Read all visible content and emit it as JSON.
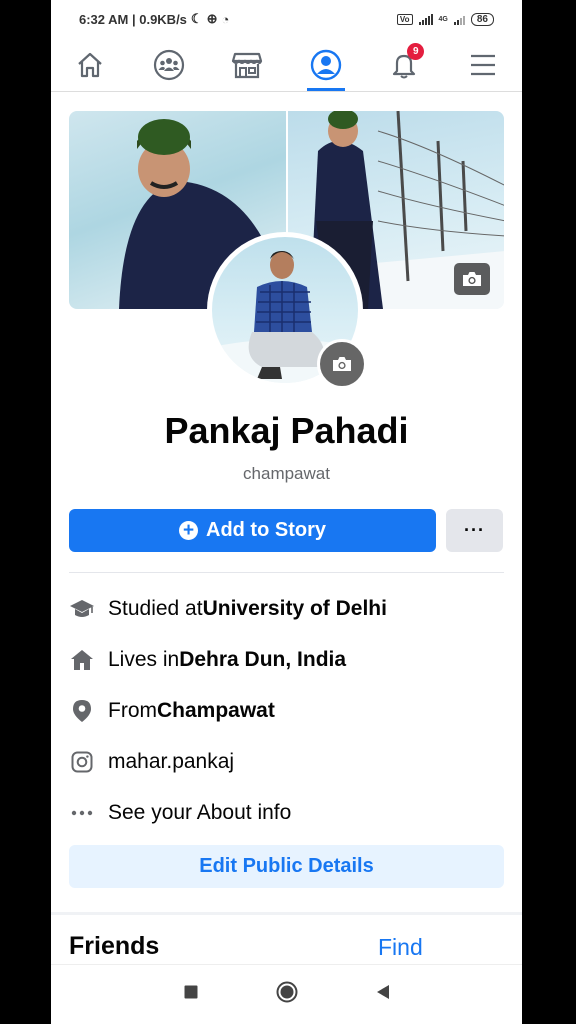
{
  "status_bar": {
    "time_speed": "6:32 AM | 0.9KB/s",
    "network_label": "4G",
    "battery": "86"
  },
  "nav": {
    "notification_count": "9"
  },
  "profile": {
    "name": "Pankaj Pahadi",
    "bio": "champawat",
    "add_story_label": "Add to Story",
    "more_label": "···"
  },
  "details": [
    {
      "prefix": "Studied at ",
      "bold": "University of Delhi",
      "icon": "graduation-cap-icon"
    },
    {
      "prefix": "Lives in ",
      "bold": "Dehra Dun, India",
      "icon": "home-icon"
    },
    {
      "prefix": "From ",
      "bold": "Champawat",
      "icon": "location-pin-icon"
    },
    {
      "prefix": "mahar.pankaj",
      "bold": "",
      "icon": "instagram-icon"
    },
    {
      "prefix": "See your About info",
      "bold": "",
      "icon": "more-dots-icon"
    }
  ],
  "edit_public_details_label": "Edit Public Details",
  "friends": {
    "title": "Friends",
    "find_label": "Find"
  },
  "colors": {
    "brand_blue": "#1877f2",
    "badge_red": "#e41e3f",
    "light_blue_bg": "#e7f3ff"
  }
}
